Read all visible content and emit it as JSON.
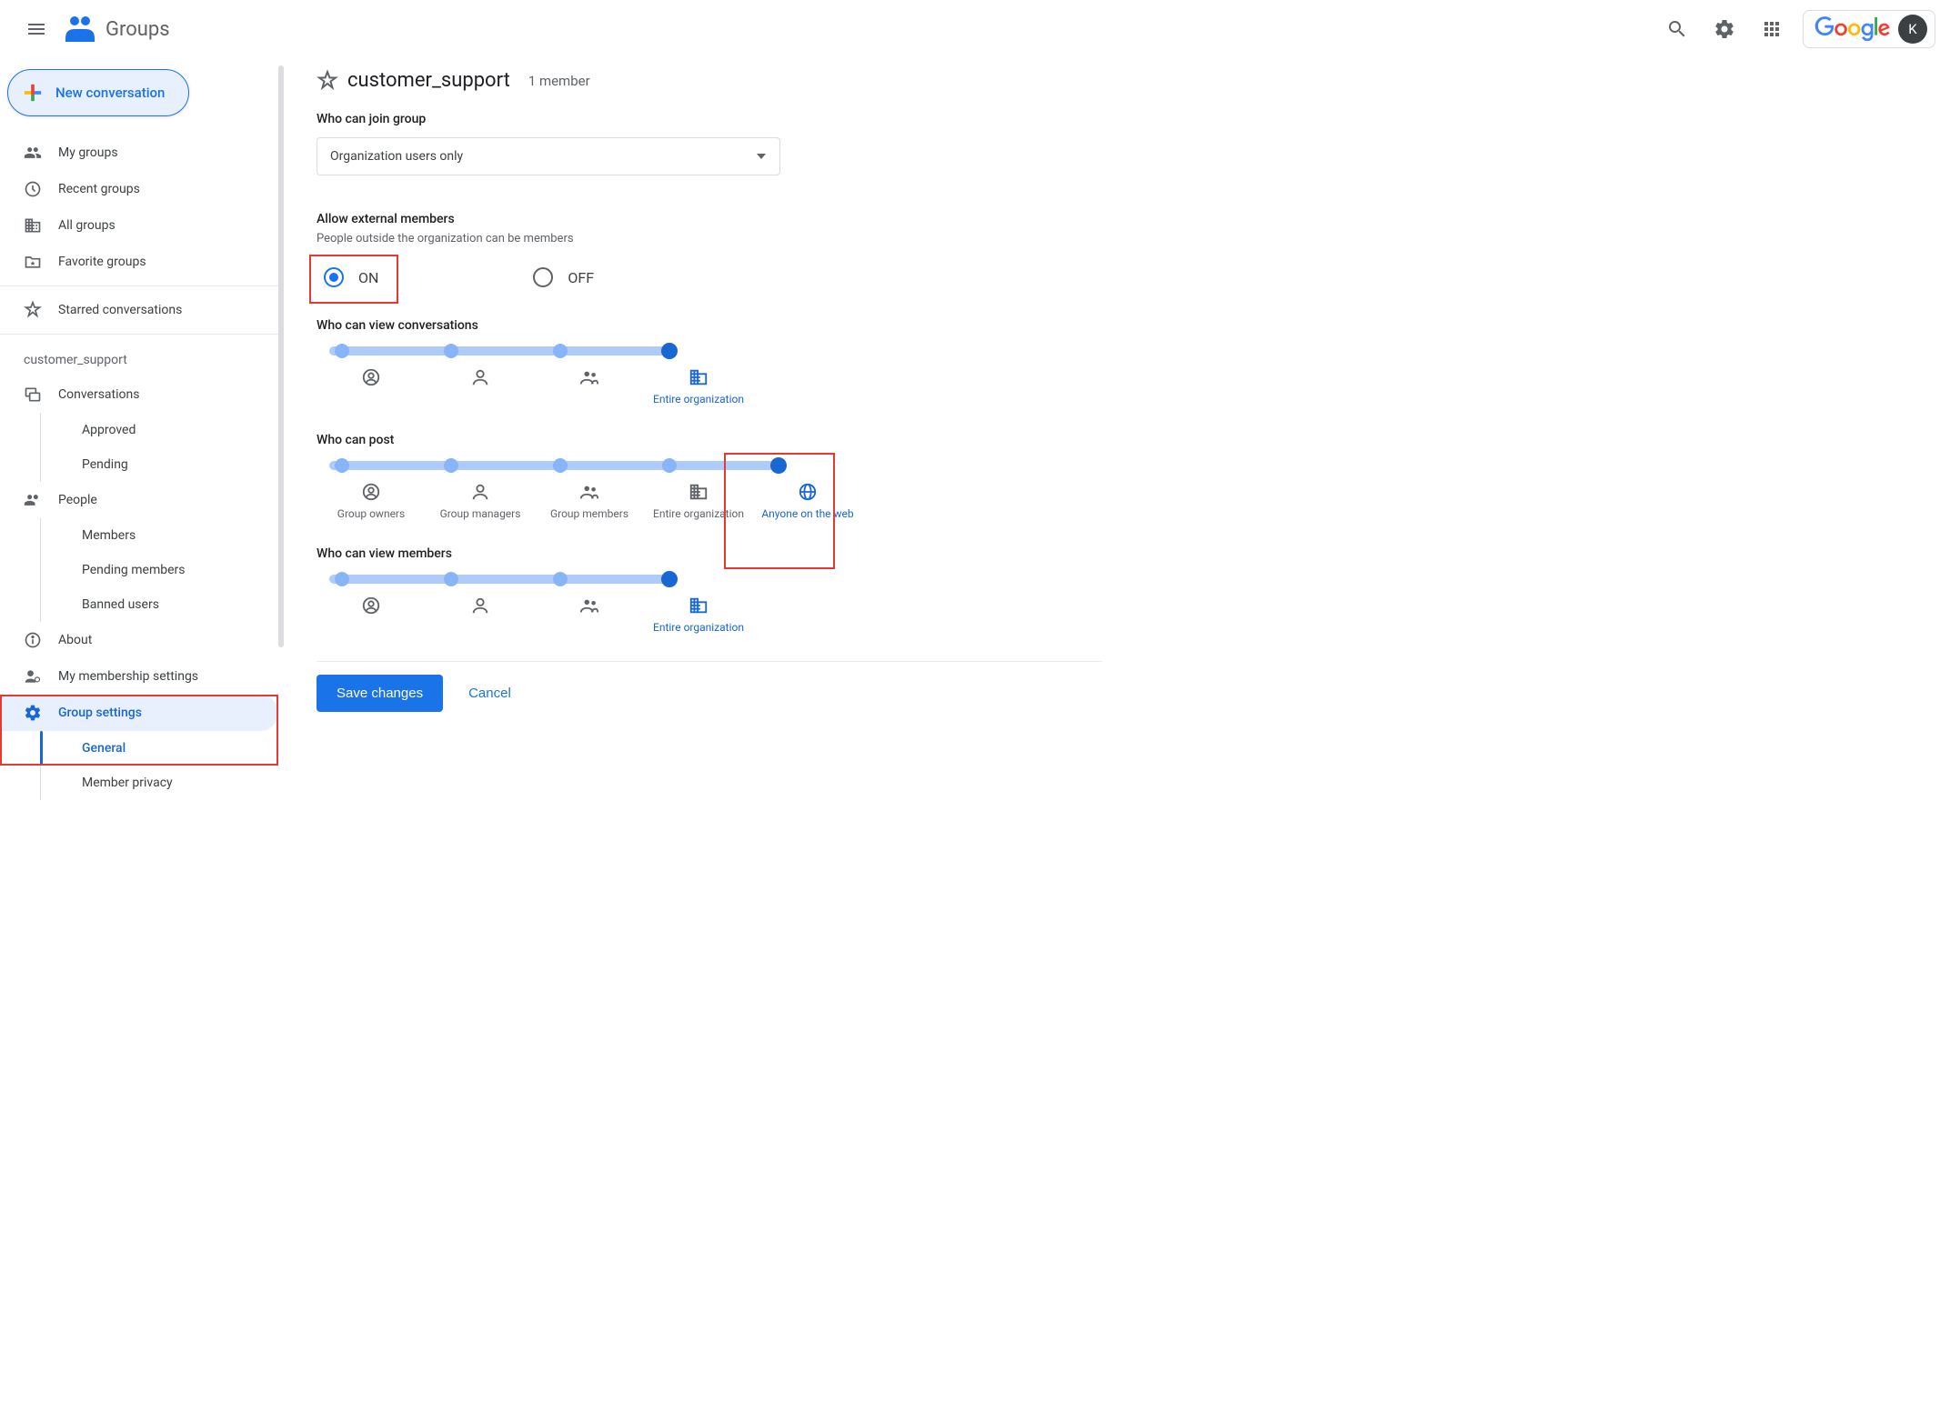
{
  "header": {
    "app_name": "Groups",
    "google_label": "Google",
    "avatar_initial": "K"
  },
  "sidebar": {
    "new_conversation": "New conversation",
    "nav": {
      "my_groups": "My groups",
      "recent_groups": "Recent groups",
      "all_groups": "All groups",
      "favorite_groups": "Favorite groups",
      "starred_conversations": "Starred conversations"
    },
    "group_label": "customer_support",
    "group_nav": {
      "conversations": "Conversations",
      "approved": "Approved",
      "pending": "Pending",
      "people": "People",
      "members": "Members",
      "pending_members": "Pending members",
      "banned_users": "Banned users",
      "about": "About",
      "my_membership": "My membership settings",
      "group_settings": "Group settings",
      "general": "General",
      "member_privacy": "Member privacy"
    }
  },
  "main": {
    "title": "customer_support",
    "member_count": "1 member",
    "who_can_join_label": "Who can join group",
    "who_can_join_value": "Organization users only",
    "external_label": "Allow external members",
    "external_sub": "People outside the organization can be members",
    "on": "ON",
    "off": "OFF",
    "view_conv_label": "Who can view conversations",
    "post_label": "Who can post",
    "view_members_label": "Who can view members",
    "opts": {
      "owners": "Group owners",
      "managers": "Group managers",
      "members": "Group members",
      "org": "Entire organization",
      "web": "Anyone on the web"
    },
    "save": "Save changes",
    "cancel": "Cancel"
  }
}
